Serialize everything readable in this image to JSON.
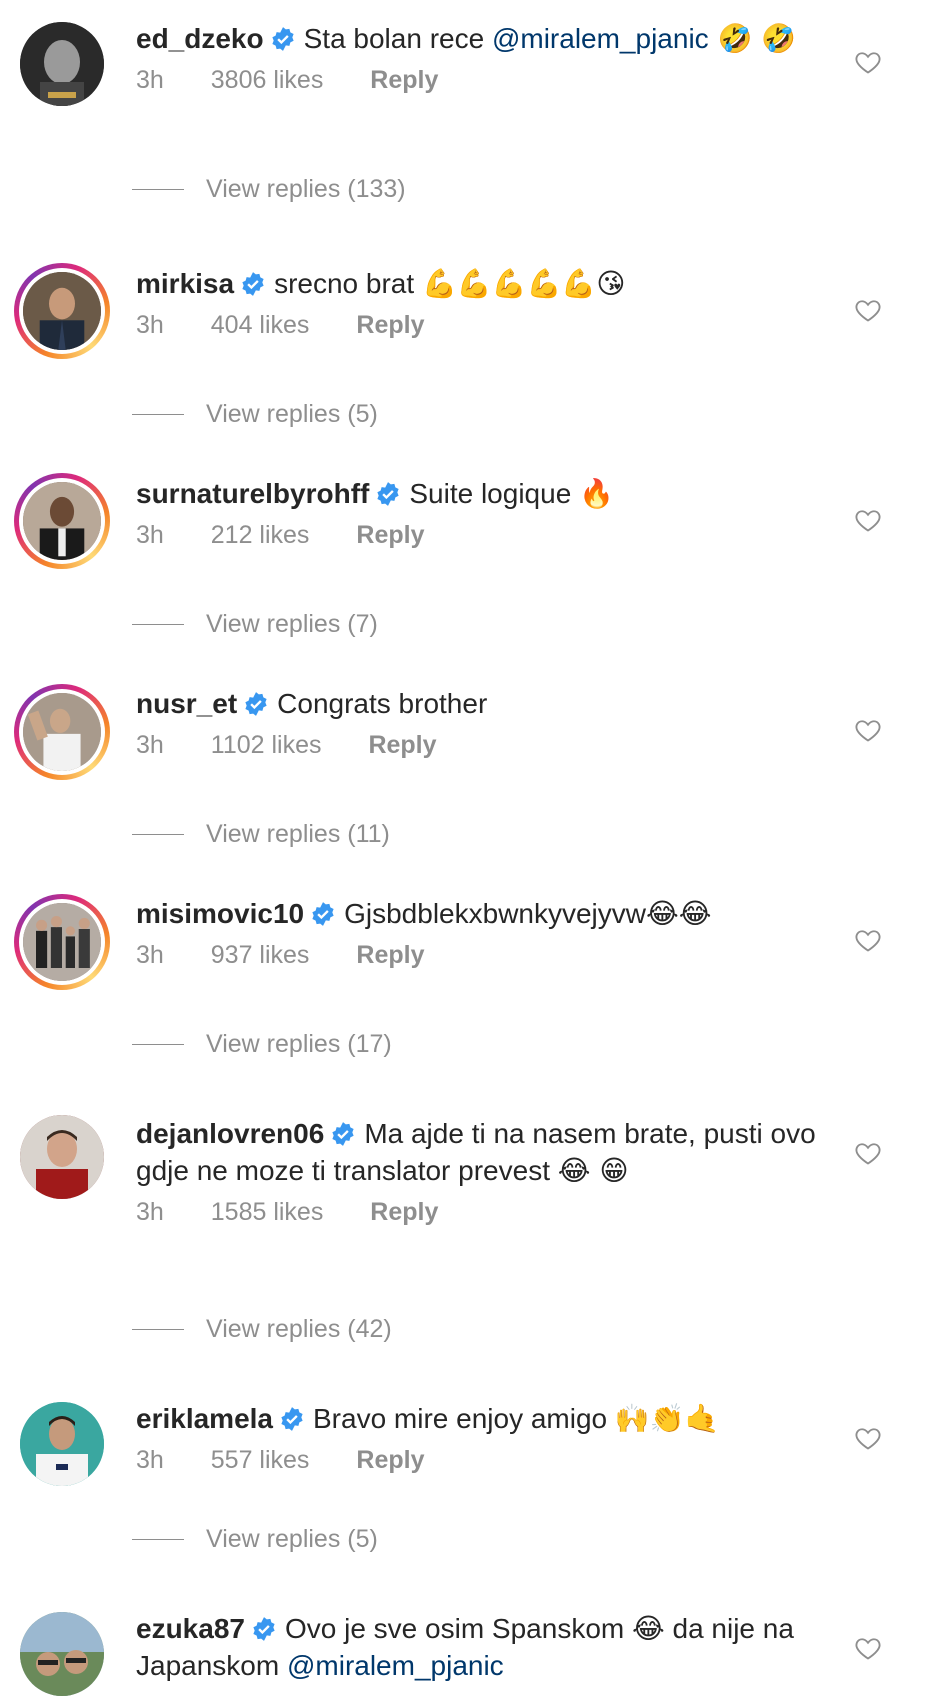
{
  "comments": [
    {
      "username": "ed_dzeko",
      "verified": true,
      "text": "Sta bolan rece ",
      "mention": "@miralem_pjanic",
      "emoji": " 🤣 🤣",
      "time": "3h",
      "likes": "3806 likes",
      "reply_label": "Reply",
      "view_replies": "View replies (133)",
      "has_story": false,
      "avatar_color": "#2b2b2b"
    },
    {
      "username": "mirkisa",
      "verified": true,
      "text": "srecno brat ",
      "mention": "",
      "emoji": "💪💪💪💪💪😘",
      "time": "3h",
      "likes": "404 likes",
      "reply_label": "Reply",
      "view_replies": "View replies (5)",
      "has_story": true,
      "avatar_color": "#5a4a3e"
    },
    {
      "username": "surnaturelbyrohff",
      "verified": true,
      "text": "Suite logique ",
      "mention": "",
      "emoji": "🔥",
      "time": "3h",
      "likes": "212 likes",
      "reply_label": "Reply",
      "view_replies": "View replies (7)",
      "has_story": true,
      "avatar_color": "#6e5a4a"
    },
    {
      "username": "nusr_et",
      "verified": true,
      "text": "Congrats brother",
      "mention": "",
      "emoji": "",
      "time": "3h",
      "likes": "1102 likes",
      "reply_label": "Reply",
      "view_replies": "View replies (11)",
      "has_story": true,
      "avatar_color": "#9a8d82"
    },
    {
      "username": "misimovic10",
      "verified": true,
      "text": "Gjsbdblekxbwnkyvejyvw",
      "mention": "",
      "emoji": "😂😂",
      "time": "3h",
      "likes": "937 likes",
      "reply_label": "Reply",
      "view_replies": "View replies (17)",
      "has_story": true,
      "avatar_color": "#7a6f66"
    },
    {
      "username": "dejanlovren06",
      "verified": true,
      "text": "Ma ajde ti na nasem brate, pusti ovo gdje ne moze ti translator prevest ",
      "mention": "",
      "emoji": "😂 😁",
      "time": "3h",
      "likes": "1585 likes",
      "reply_label": "Reply",
      "view_replies": "View replies (42)",
      "has_story": false,
      "avatar_color": "#8a3b3b"
    },
    {
      "username": "eriklamela",
      "verified": true,
      "text": "Bravo mire enjoy amigo ",
      "mention": "",
      "emoji": "🙌👏🤙",
      "time": "3h",
      "likes": "557 likes",
      "reply_label": "Reply",
      "view_replies": "View replies (5)",
      "has_story": false,
      "avatar_color": "#3aa7a0"
    },
    {
      "username": "ezuka87",
      "verified": true,
      "text": "Ovo je sve osim Spanskom ",
      "text2": " da nije na Japanskom ",
      "mention": "@miralem_pjanic",
      "emoji": "😂",
      "time": "",
      "likes": "",
      "reply_label": "",
      "view_replies": "",
      "has_story": false,
      "avatar_color": "#6a8a5a"
    }
  ],
  "colors": {
    "text": "#262626",
    "secondary": "#8e8e8e",
    "mention": "#00376b",
    "verified": "#3897f0"
  },
  "icons": {
    "verified": "verified-badge-icon",
    "heart": "heart-outline-icon"
  }
}
